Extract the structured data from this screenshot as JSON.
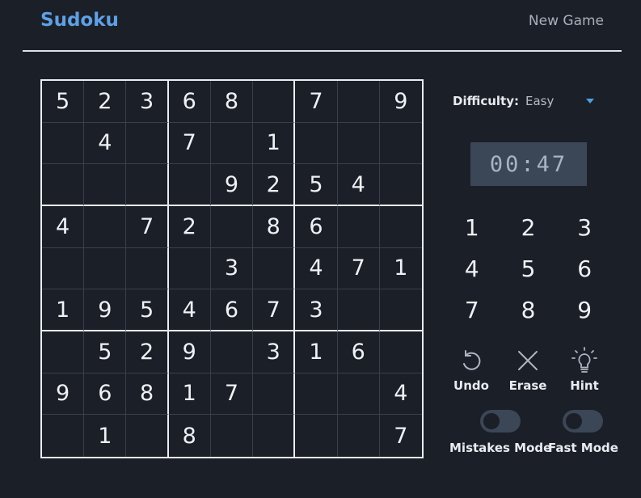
{
  "header": {
    "title": "Sudoku",
    "new_game_label": "New Game"
  },
  "board": [
    [
      "5",
      "2",
      "3",
      "6",
      "8",
      "",
      "7",
      "",
      "9"
    ],
    [
      "",
      "4",
      "",
      "7",
      "",
      "1",
      "",
      "",
      ""
    ],
    [
      "",
      "",
      "",
      "",
      "9",
      "2",
      "5",
      "4",
      ""
    ],
    [
      "4",
      "",
      "7",
      "2",
      "",
      "8",
      "6",
      "",
      ""
    ],
    [
      "",
      "",
      "",
      "",
      "3",
      "",
      "4",
      "7",
      "1"
    ],
    [
      "1",
      "9",
      "5",
      "4",
      "6",
      "7",
      "3",
      "",
      ""
    ],
    [
      "",
      "5",
      "2",
      "9",
      "",
      "3",
      "1",
      "6",
      ""
    ],
    [
      "9",
      "6",
      "8",
      "1",
      "7",
      "",
      "",
      "",
      "4"
    ],
    [
      "",
      "1",
      "",
      "8",
      "",
      "",
      "",
      "",
      "7"
    ]
  ],
  "difficulty": {
    "label": "Difficulty:",
    "selected": "Easy"
  },
  "timer": "00:47",
  "numpad": [
    "1",
    "2",
    "3",
    "4",
    "5",
    "6",
    "7",
    "8",
    "9"
  ],
  "actions": {
    "undo": {
      "label": "Undo",
      "icon": "undo-icon"
    },
    "erase": {
      "label": "Erase",
      "icon": "close-icon"
    },
    "hint": {
      "label": "Hint",
      "icon": "lightbulb-icon"
    }
  },
  "toggles": {
    "mistakes_mode": {
      "label": "Mistakes Mode",
      "on": false
    },
    "fast_mode": {
      "label": "Fast Mode",
      "on": false
    }
  },
  "colors": {
    "background": "#1b1f27",
    "accent": "#5ea0e6",
    "timer_bg": "#3b4656",
    "dropdown_arrow": "#4aa3e0"
  }
}
